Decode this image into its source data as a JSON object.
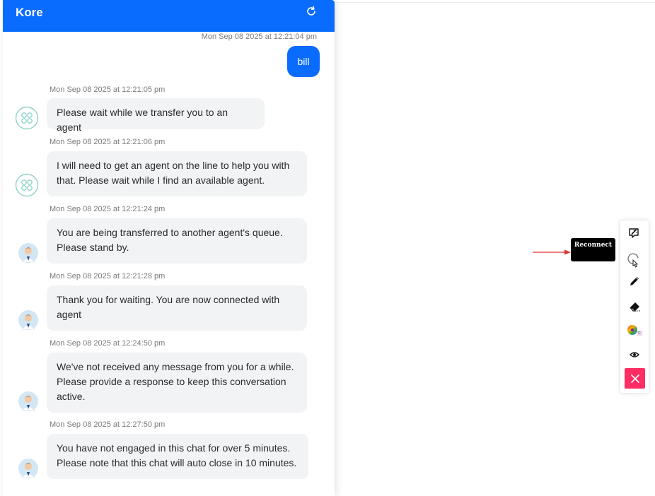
{
  "chat": {
    "title": "Kore",
    "user_message": {
      "timestamp": "Mon Sep 08 2025 at 12:21:04 pm",
      "text": "bill"
    },
    "messages": [
      {
        "timestamp": "Mon Sep 08 2025 at 12:21:05 pm",
        "lines": [
          "Please wait while we transfer you to an agent"
        ],
        "avatar": "bot-avatar-icon"
      },
      {
        "timestamp": "Mon Sep 08 2025 at 12:21:06 pm",
        "lines": [
          "I will need to get an agent on the line to help you with",
          "that. Please wait while I find an available agent."
        ],
        "avatar": "bot-avatar-icon"
      },
      {
        "timestamp": "Mon Sep 08 2025 at 12:21:24 pm",
        "lines": [
          "You are being transferred to another agent's queue.",
          "Please stand by."
        ],
        "avatar": "agent-avatar-icon"
      },
      {
        "timestamp": "Mon Sep 08 2025 at 12:21:28 pm",
        "lines": [
          "Thank you for waiting. You are now connected with",
          "agent"
        ],
        "avatar": "agent-avatar-icon"
      },
      {
        "timestamp": "Mon Sep 08 2025 at 12:24:50 pm",
        "lines": [
          "We've not received any message from you for a while.",
          "Please provide a response to keep this conversation",
          "active."
        ],
        "avatar": "agent-avatar-icon"
      },
      {
        "timestamp": "Mon Sep 08 2025 at 12:27:50 pm",
        "lines": [
          "You have not engaged in this chat for over 5 minutes.",
          "Please note that this chat will auto close in 10 minutes."
        ],
        "avatar": "agent-avatar-icon"
      }
    ]
  },
  "toolbar": {
    "icons": [
      "magic-wand-icon",
      "reconnect-icon",
      "pen-icon",
      "eraser-icon",
      "color-picker-icon",
      "eye-icon",
      "close-icon"
    ],
    "tooltip": "Reconnect"
  },
  "colors": {
    "header": "#0a6cff",
    "user_bubble": "#0a6cff",
    "bot_bubble": "#f2f3f5",
    "close_button": "#ff2d64",
    "arrow": "#e0312f"
  }
}
